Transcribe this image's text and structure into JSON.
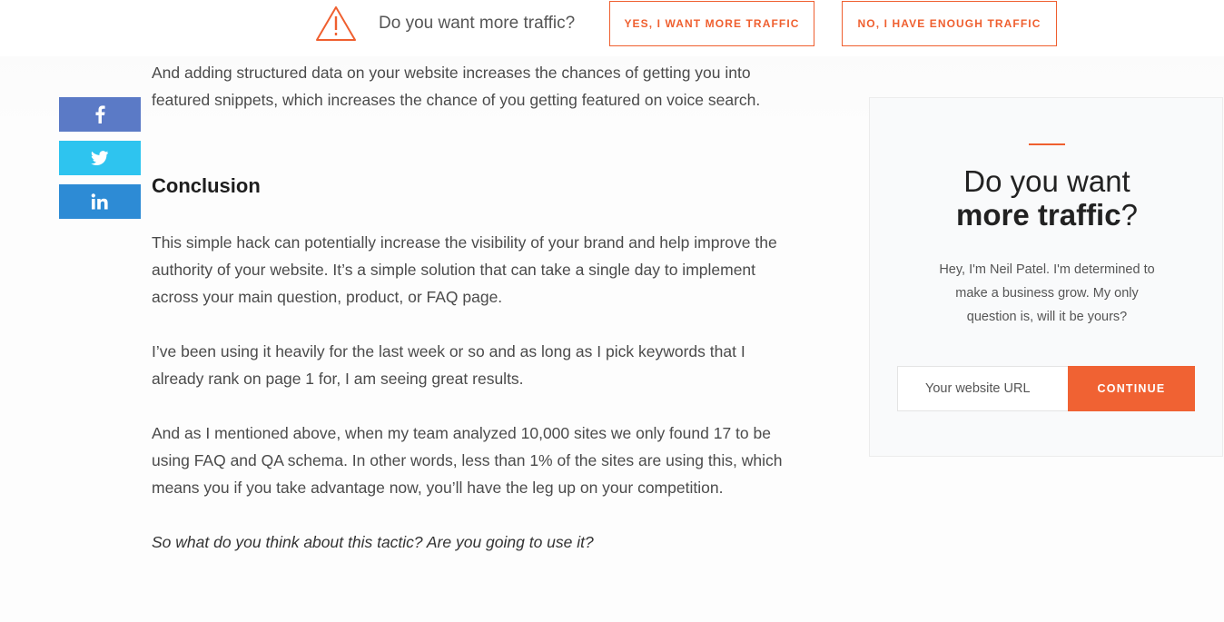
{
  "topbar": {
    "question": "Do you want more traffic?",
    "yes_label": "YES, I WANT MORE TRAFFIC",
    "no_label": "NO, I HAVE ENOUGH TRAFFIC",
    "icon": "warning-triangle-icon"
  },
  "social": {
    "facebook": {
      "glyph": "f",
      "icon": "facebook-icon",
      "color": "#5b7ac6"
    },
    "twitter": {
      "icon": "twitter-icon",
      "color": "#2ec4ef"
    },
    "linkedin": {
      "glyph": "in",
      "icon": "linkedin-icon",
      "color": "#2d8bd5"
    }
  },
  "article": {
    "intro_paragraph": "And adding structured data on your website increases the chances of getting you into featured snippets, which increases the chance of you getting featured on voice search.",
    "conclusion_heading": "Conclusion",
    "paragraph_1": "This simple hack can potentially increase the visibility of your brand and help improve the authority of your website. It’s a simple solution that can take a single day to implement across your main question, product, or FAQ page.",
    "paragraph_2": "I’ve been using it heavily for the last week or so and as long as I pick keywords that I already rank on page 1 for, I am seeing great results.",
    "paragraph_3": "And as I mentioned above, when my team analyzed 10,000 sites we only found 17 to be using FAQ and QA schema. In other words, less than 1% of the sites are using this, which means you if you take advantage now, you’ll have the leg up on your competition.",
    "closing_question": "So what do you think about this tactic? Are you going to use it?"
  },
  "sidebar": {
    "title_line1": "Do you want",
    "title_bold": "more traffic",
    "title_suffix": "?",
    "text": "Hey, I'm Neil Patel. I'm determined to make a business grow. My only question is, will it be yours?",
    "url_placeholder": "Your website URL",
    "continue_label": "CONTINUE"
  },
  "colors": {
    "accent": "#ef5f2f",
    "button_fill": "#f06233"
  }
}
